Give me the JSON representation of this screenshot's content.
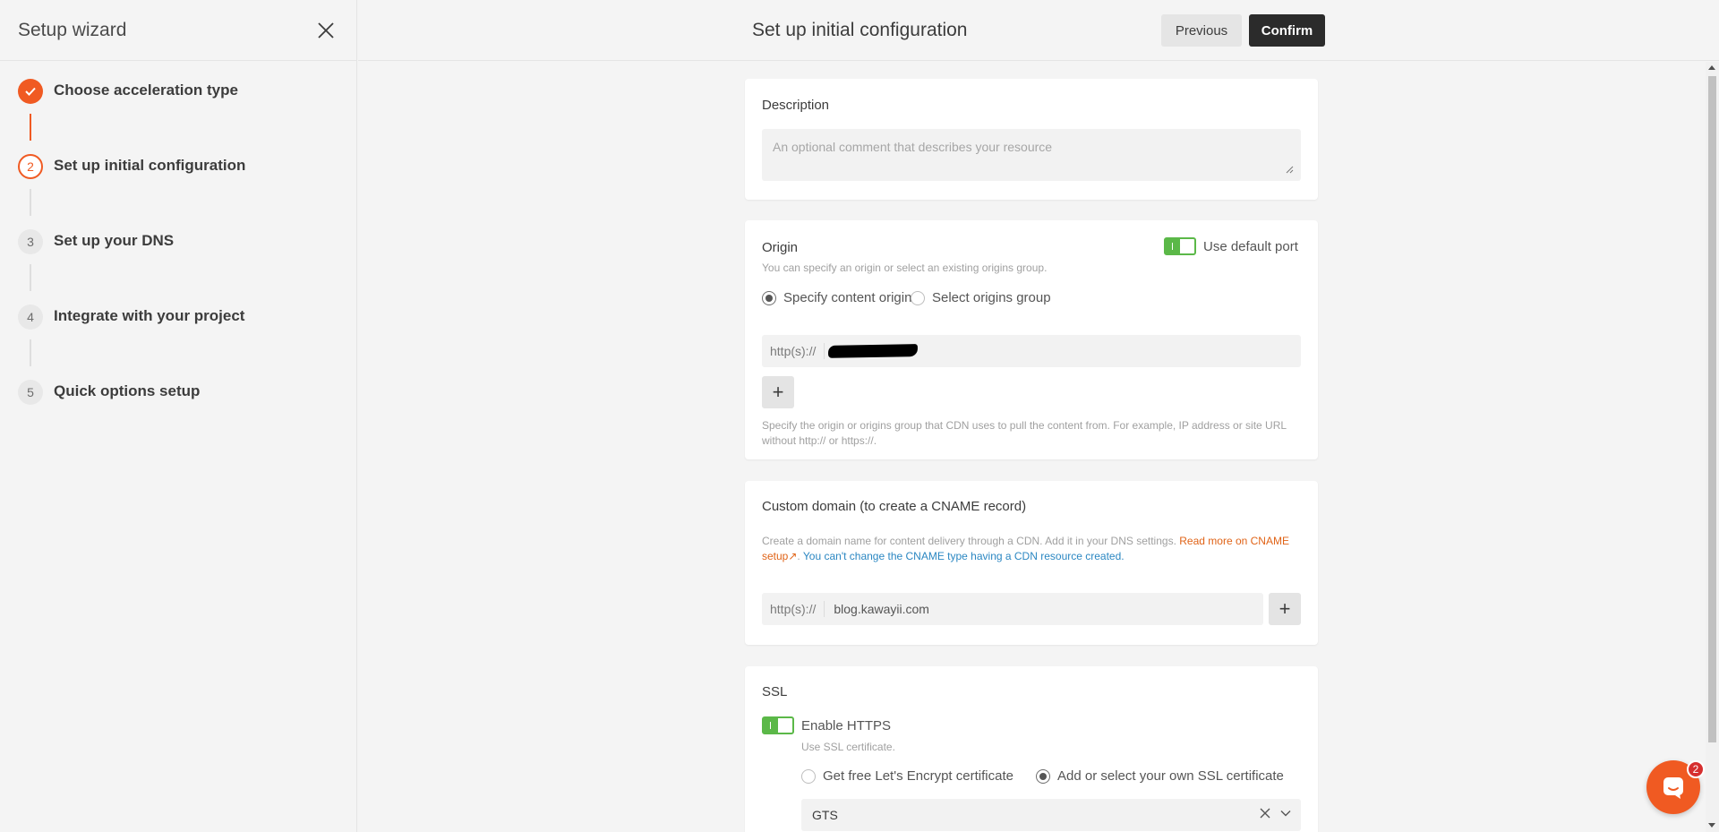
{
  "sidebar": {
    "title": "Setup wizard",
    "steps": [
      {
        "number": "",
        "label": "Choose acceleration type",
        "state": "done"
      },
      {
        "number": "2",
        "label": "Set up initial configuration",
        "state": "active"
      },
      {
        "number": "3",
        "label": "Set up your DNS",
        "state": "pending"
      },
      {
        "number": "4",
        "label": "Integrate with your project",
        "state": "pending"
      },
      {
        "number": "5",
        "label": "Quick options setup",
        "state": "pending"
      }
    ]
  },
  "header": {
    "title": "Set up initial configuration",
    "previous_label": "Previous",
    "confirm_label": "Confirm"
  },
  "description": {
    "title": "Description",
    "placeholder": "An optional comment that describes your resource"
  },
  "origin": {
    "title": "Origin",
    "subtitle": "You can specify an origin or select an existing origins group.",
    "default_port_label": "Use default port",
    "radio_specify": "Specify content origin",
    "radio_group": "Select origins group",
    "prefix": "http(s)://",
    "add_label": "+",
    "help": "Specify the origin or origins group that CDN uses to pull the content from. For example, IP address or site URL without http:// or https://."
  },
  "custom_domain": {
    "title": "Custom domain (to create a CNAME record)",
    "help": "Create a domain name for content delivery through a CDN. Add it in your DNS settings.",
    "link_text": "Read more on CNAME setup",
    "link_arrow": "↗",
    "separator": ".",
    "warning": "You can't change the CNAME type having a CDN resource created.",
    "prefix": "http(s)://",
    "value": "blog.kawayii.com",
    "add_label": "+"
  },
  "ssl": {
    "title": "SSL",
    "enable_label": "Enable HTTPS",
    "enable_hint": "Use SSL certificate.",
    "radio_free": "Get free Let's Encrypt certificate",
    "radio_own": "Add or select your own SSL certificate",
    "selected_cert": "GTS"
  },
  "chat": {
    "badge": "2"
  },
  "colors": {
    "accent": "#f05a22",
    "toggle_on": "#5bb848",
    "link_orange": "#e06317",
    "link_blue": "#2b87c2"
  }
}
